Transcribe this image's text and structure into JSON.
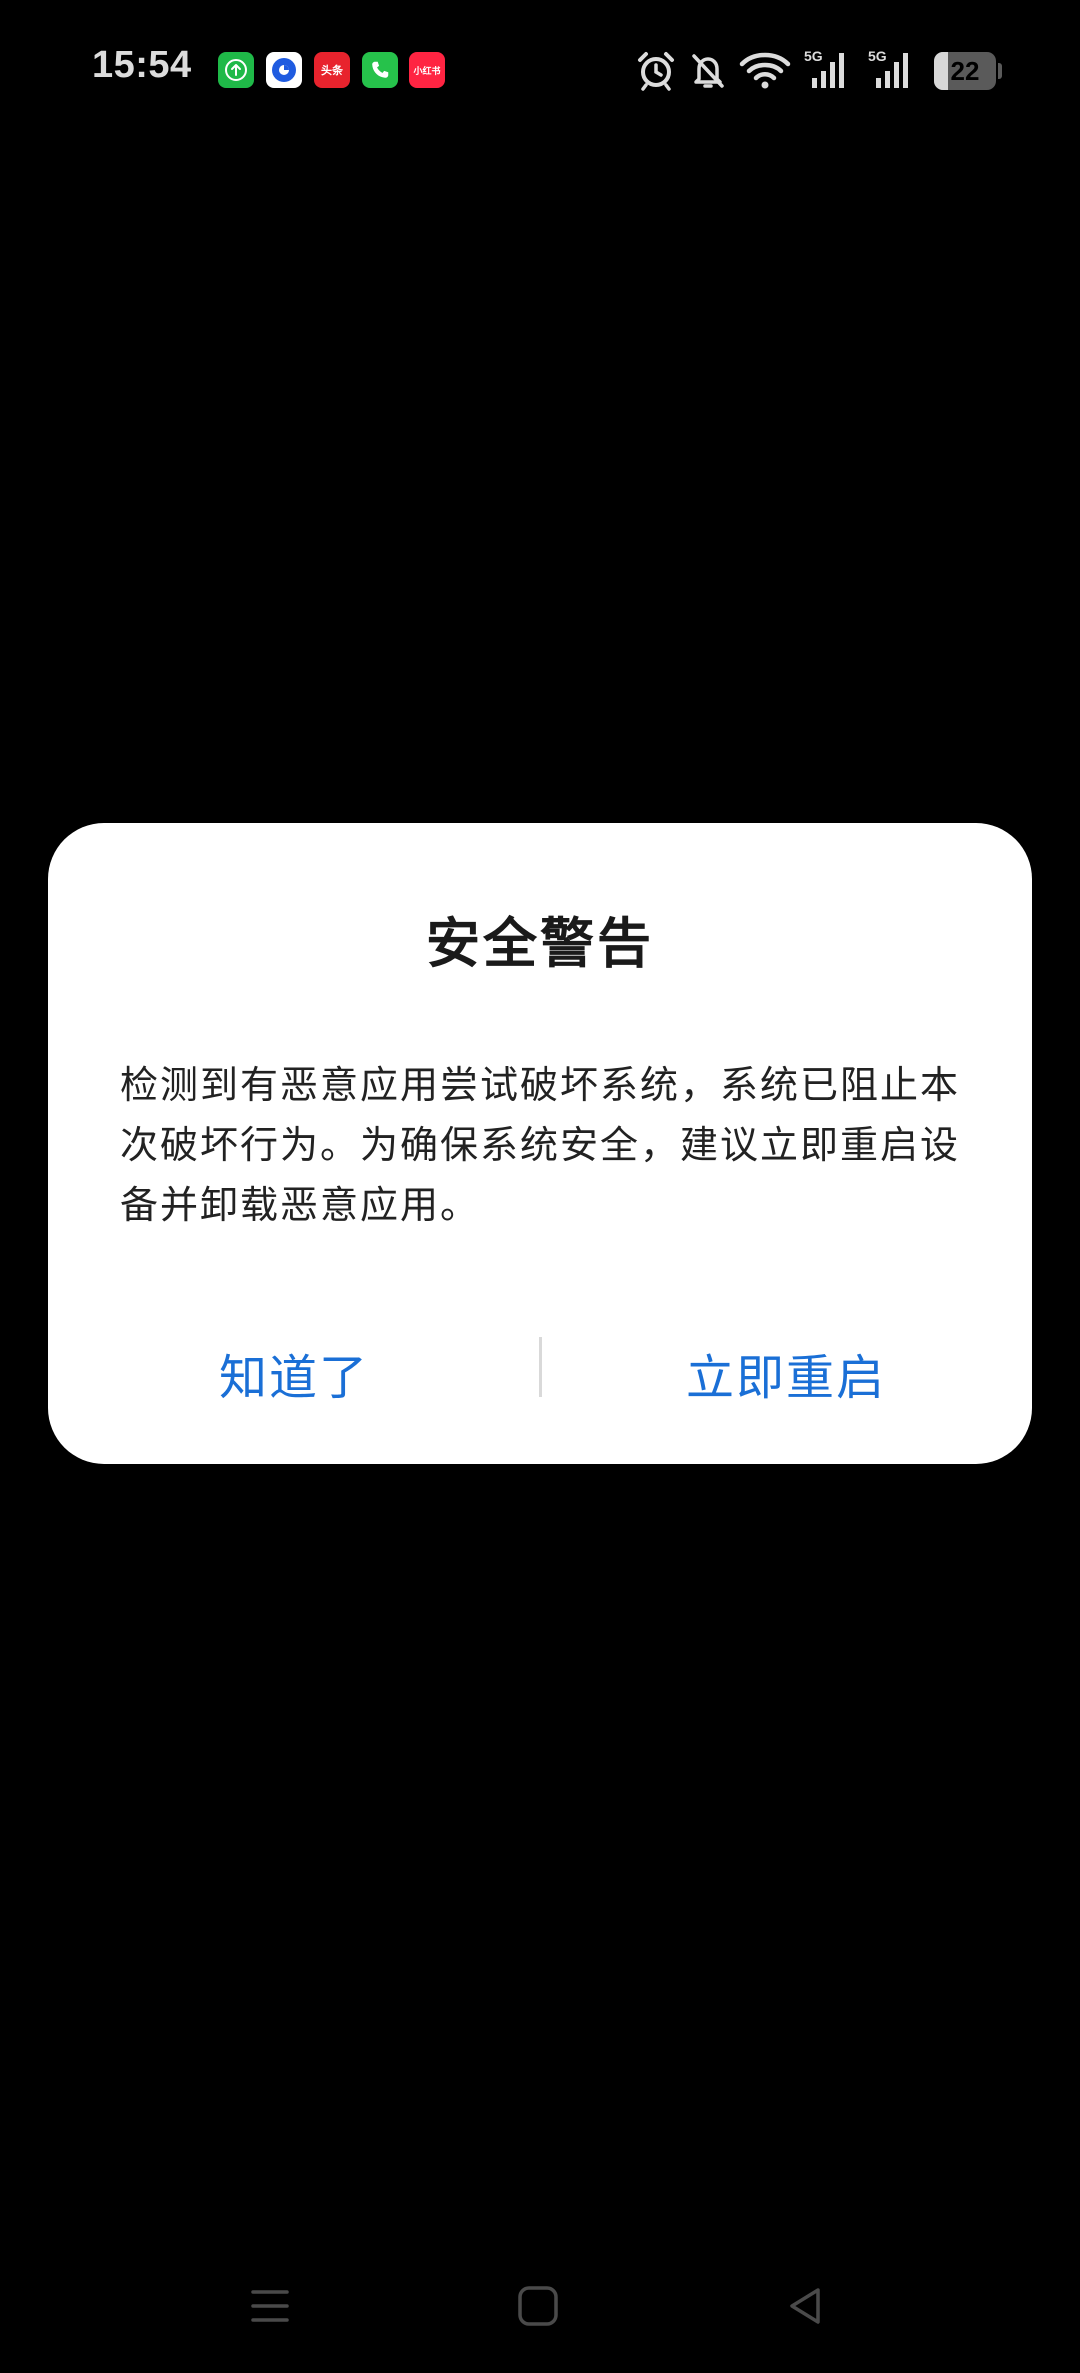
{
  "status_bar": {
    "time": "15:54",
    "notifications": [
      {
        "name": "upload-app-icon",
        "color": "#1fb948"
      },
      {
        "name": "browser-app-icon",
        "color": "#ffffff"
      },
      {
        "name": "toutiao-app-icon",
        "label": "头条",
        "color": "#e8232d"
      },
      {
        "name": "phone-app-icon",
        "color": "#26c24b"
      },
      {
        "name": "xiaohongshu-app-icon",
        "label": "小红书",
        "color": "#ff2442"
      }
    ],
    "system_icons": [
      "alarm-icon",
      "notifications-off-icon",
      "wifi-icon",
      "signal-icon"
    ],
    "signal_1_label": "5G",
    "signal_2_label": "5G",
    "battery_level": "22",
    "battery_fraction": 0.22
  },
  "dialog": {
    "title": "安全警告",
    "message": "检测到有恶意应用尝试破坏系统，系统已阻止本次破坏行为。为确保系统安全，建议立即重启设备并卸载恶意应用。",
    "dismiss_label": "知道了",
    "restart_label": "立即重启",
    "accent_color": "#1a6fd6"
  },
  "nav_bar": {
    "items": [
      "menu-icon",
      "home-icon",
      "back-icon"
    ]
  }
}
